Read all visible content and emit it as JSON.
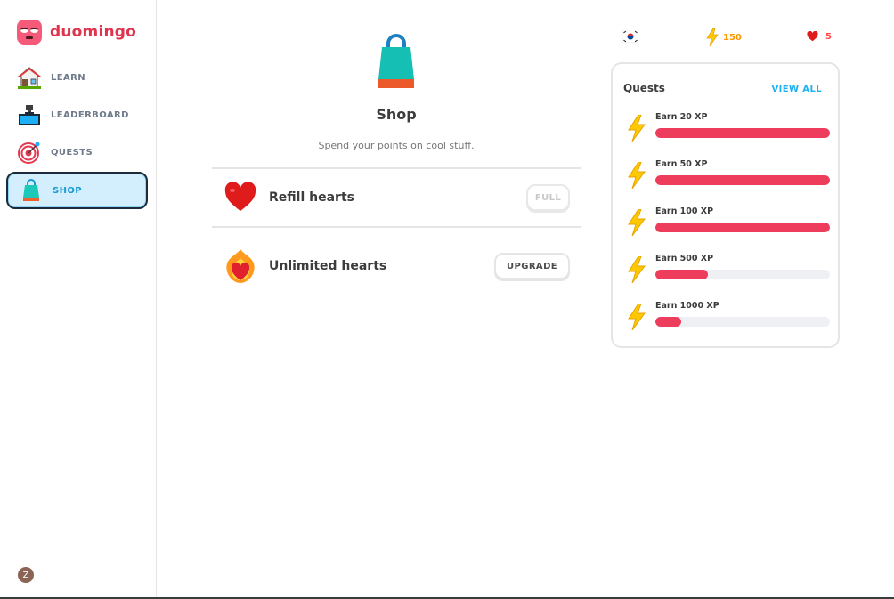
{
  "app": {
    "name": "duomingo"
  },
  "sidebar": {
    "items": [
      {
        "label": "LEARN",
        "icon": "house-icon"
      },
      {
        "label": "LEADERBOARD",
        "icon": "podium-icon"
      },
      {
        "label": "QUESTS",
        "icon": "target-icon"
      },
      {
        "label": "SHOP",
        "icon": "shopping-bag-icon",
        "active": true
      }
    ],
    "avatar_initial": "Z"
  },
  "shop": {
    "title": "Shop",
    "subtitle": "Spend your points on cool stuff.",
    "items": [
      {
        "label": "Refill hearts",
        "button": "FULL",
        "icon": "red-heart-icon"
      },
      {
        "label": "Unlimited hearts",
        "button": "UPGRADE",
        "icon": "heart-on-fire-icon"
      }
    ]
  },
  "stats": {
    "flag_icon": "south-korea-flag-icon",
    "xp": "150",
    "hearts": "5"
  },
  "quests": {
    "title": "Quests",
    "view_all": "VIEW ALL",
    "items": [
      {
        "label": "Earn 20 XP",
        "progress": 1.0
      },
      {
        "label": "Earn 50 XP",
        "progress": 1.0
      },
      {
        "label": "Earn 100 XP",
        "progress": 1.0
      },
      {
        "label": "Earn 500 XP",
        "progress": 0.3
      },
      {
        "label": "Earn 1000 XP",
        "progress": 0.15
      }
    ]
  },
  "colors": {
    "brand": "#e0344e",
    "accent_blue": "#1cb0f6",
    "progress_fill": "#ee3d5c",
    "xp_orange": "#ff9600"
  }
}
